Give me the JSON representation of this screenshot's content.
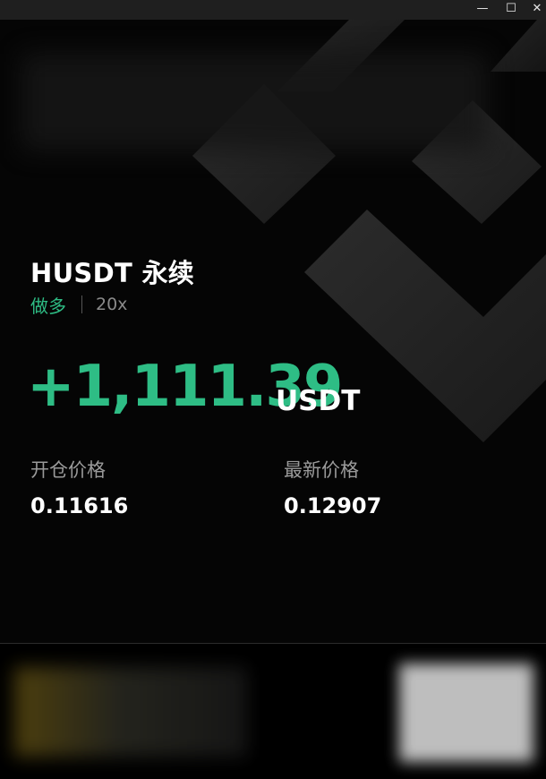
{
  "window": {
    "minimize_glyph": "—",
    "maximize_glyph": "☐",
    "close_glyph": "✕"
  },
  "card": {
    "pair_title": "HUSDT 永续",
    "side": "做多",
    "leverage": "20x",
    "pnl_value": "+1,111.39",
    "pnl_unit": "USDT",
    "open_price_label": "开仓价格",
    "open_price": "0.11616",
    "last_price_label": "最新价格",
    "last_price": "0.12907"
  },
  "colors": {
    "profit_green": "#2ebd85",
    "background": "#000000",
    "text_primary": "#ffffff",
    "text_secondary": "#9a9a9a"
  },
  "icons": {
    "background_logo": "binance-logo-icon"
  }
}
